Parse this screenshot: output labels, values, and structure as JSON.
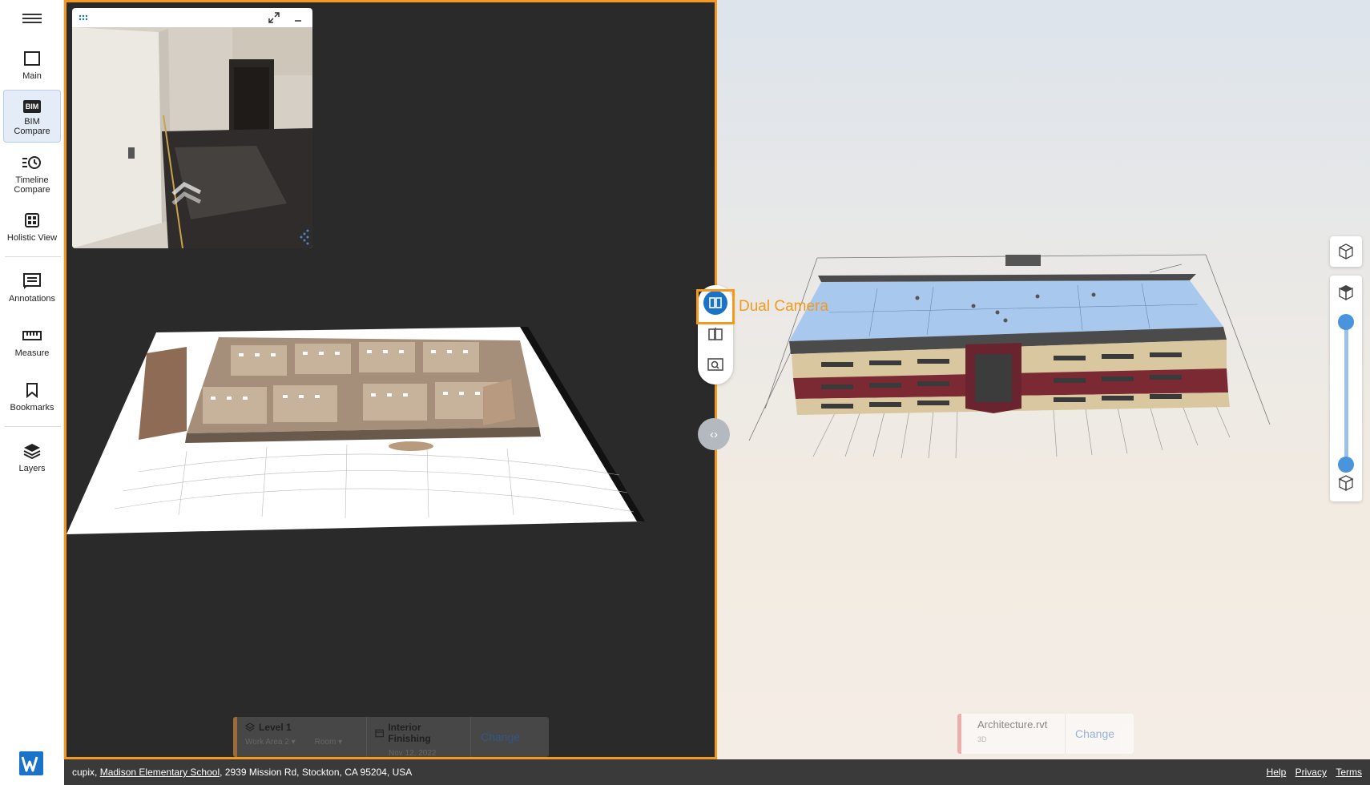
{
  "sidebar": {
    "items": [
      {
        "label": "Main",
        "icon": "square-icon"
      },
      {
        "label": "BIM Compare",
        "icon": "bim-icon",
        "active": true
      },
      {
        "label": "Timeline Compare",
        "icon": "timeline-clock-icon"
      },
      {
        "label": "Holistic View",
        "icon": "grid-icon"
      },
      {
        "label": "Annotations",
        "icon": "annotation-list-icon"
      },
      {
        "label": "Measure",
        "icon": "ruler-icon"
      },
      {
        "label": "Bookmarks",
        "icon": "bookmark-icon"
      },
      {
        "label": "Layers",
        "icon": "layers-icon"
      }
    ],
    "bim_icon_text": "BIM"
  },
  "left_selector": {
    "level": "Level 1",
    "work_area": "Work Area 2",
    "room": "Room",
    "phase": "Interior Finishing",
    "date": "Nov 12, 2022",
    "change": "Change"
  },
  "right_selector": {
    "model": "Architecture.rvt",
    "type": "3D",
    "change": "Change"
  },
  "camera_tools": {
    "dual_label": "Dual Camera"
  },
  "footer": {
    "prefix": "cupix,",
    "project_link": "Madison Elementary School",
    "address": ", 2939 Mission Rd, Stockton, CA 95204, USA",
    "links": [
      "Help",
      "Privacy",
      "Terms"
    ]
  },
  "colors": {
    "accent_orange": "#f39a1e",
    "brand_blue": "#1a73c9",
    "footer_bg": "#3a3a3a"
  }
}
